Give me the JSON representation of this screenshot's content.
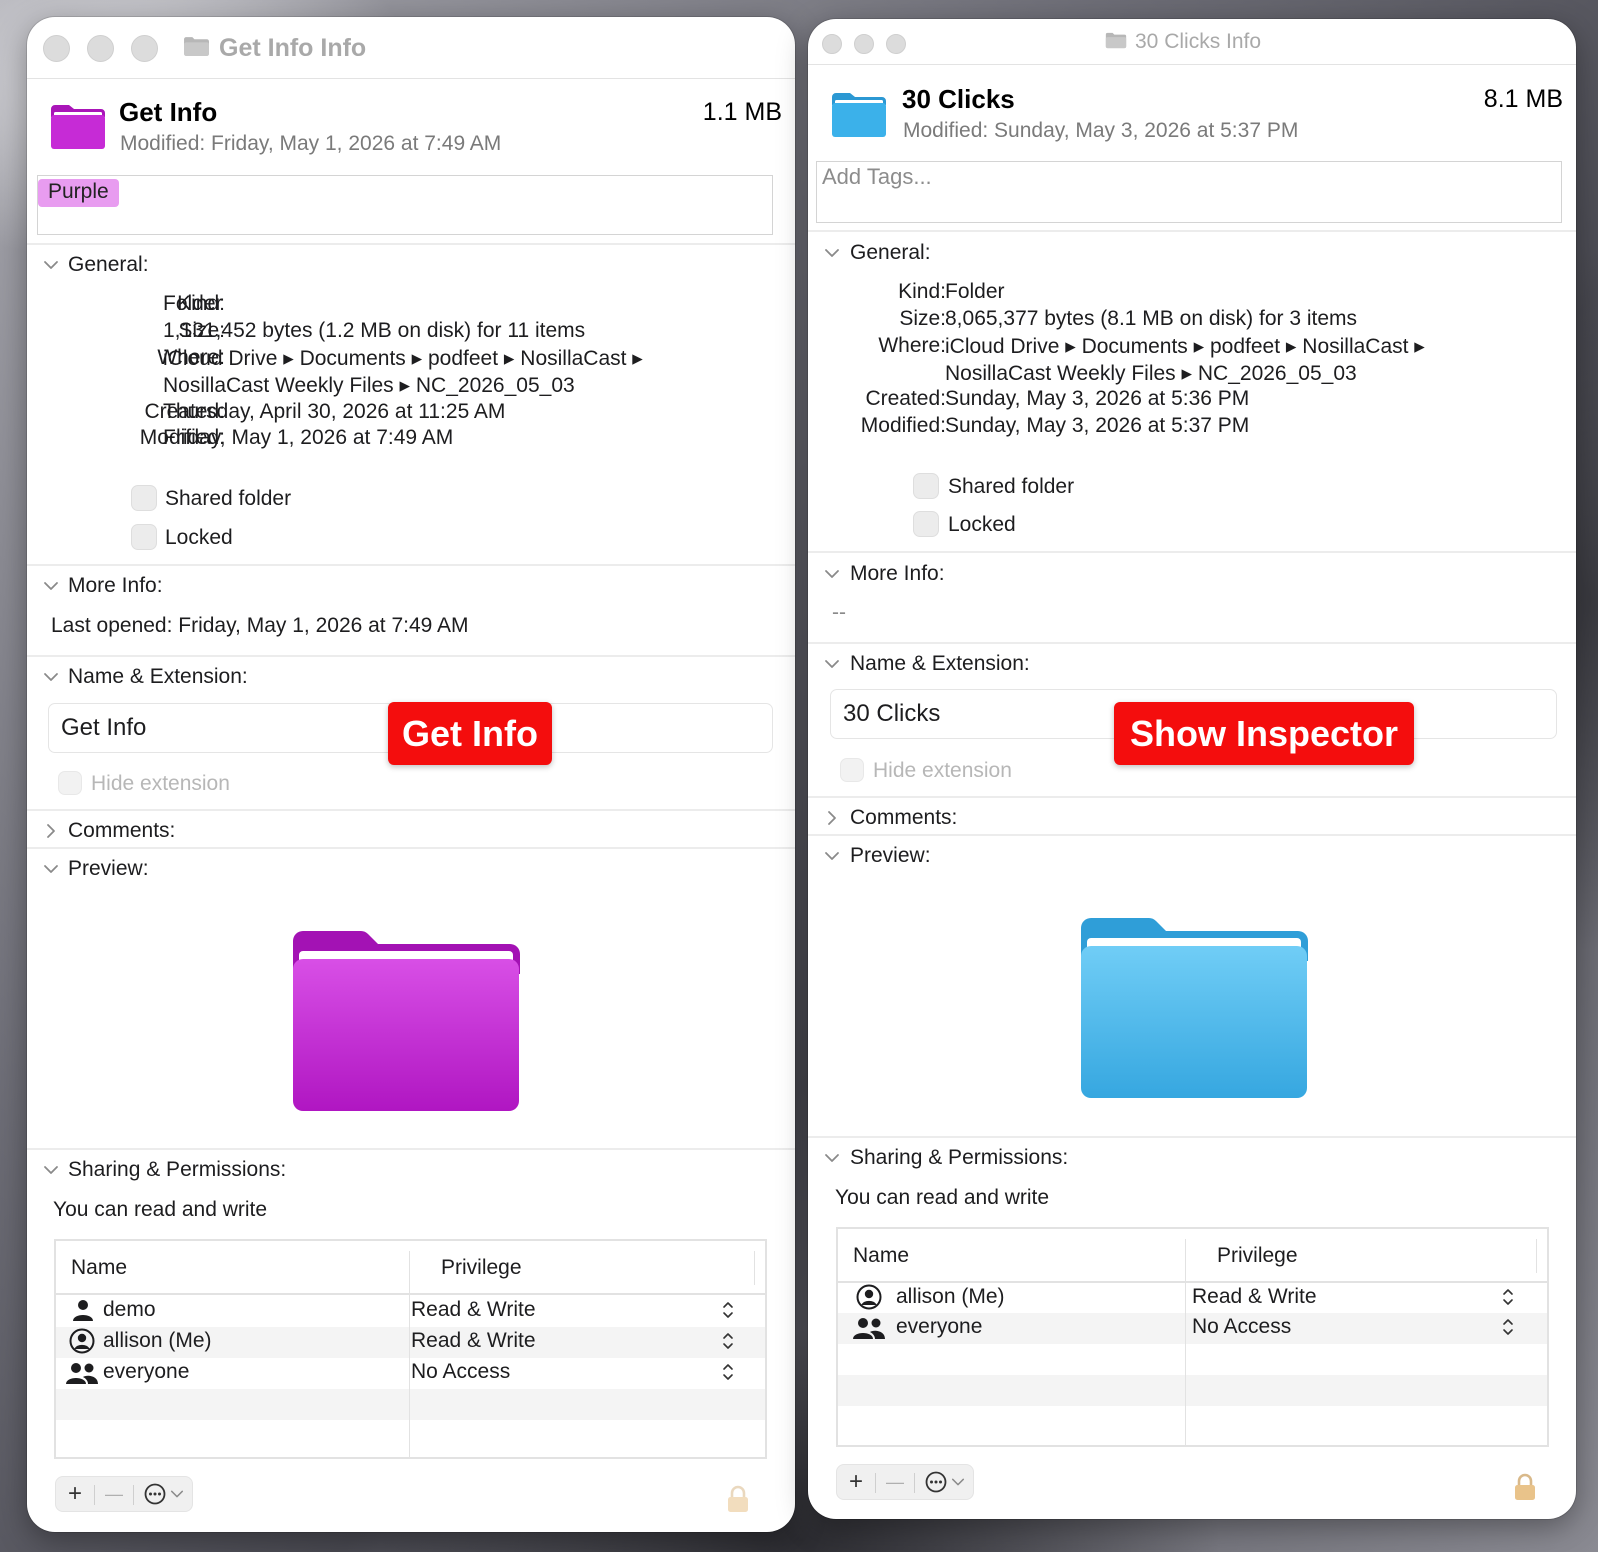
{
  "left": {
    "window_title": "Get Info Info",
    "file_name": "Get Info",
    "file_size": "1.1 MB",
    "modified_line": "Modified:  Friday, May 1, 2026 at 7:49 AM",
    "tag": "Purple",
    "folder_color": "#c62bd6",
    "general_title": "General:",
    "general": {
      "kind_label": "Kind:",
      "kind": "Folder",
      "size_label": "Size:",
      "size": "1,131,452 bytes (1.2 MB on disk) for 11 items",
      "where_label": "Where:",
      "where_1": "iCloud Drive ▸ Documents ▸ podfeet ▸ NosillaCast ▸",
      "where_2": "NosillaCast Weekly Files ▸ NC_2026_05_03",
      "created_label": "Created:",
      "created": "Thursday, April 30, 2026 at 11:25 AM",
      "modified_label": "Modified:",
      "modified": "Friday, May 1, 2026 at 7:49 AM"
    },
    "shared_folder": "Shared folder",
    "locked": "Locked",
    "more_info_title": "More Info:",
    "last_opened": "Last opened:  Friday, May 1, 2026 at 7:49 AM",
    "name_ext_title": "Name & Extension:",
    "name_value": "Get Info",
    "hide_extension": "Hide extension",
    "overlay_label": "Get Info",
    "comments_title": "Comments:",
    "preview_title": "Preview:",
    "sharing_title": "Sharing & Permissions:",
    "sharing_note": "You can read and write",
    "col_name": "Name",
    "col_privilege": "Privilege",
    "rows": [
      {
        "name": "demo",
        "privilege": "Read & Write",
        "icon": "person-icon"
      },
      {
        "name": "allison (Me)",
        "privilege": "Read & Write",
        "icon": "person-circle-icon"
      },
      {
        "name": "everyone",
        "privilege": "No Access",
        "icon": "people-icon"
      }
    ]
  },
  "right": {
    "window_title": "30 Clicks Info",
    "file_name": "30 Clicks",
    "file_size": "8.1 MB",
    "modified_line": "Modified:  Sunday, May 3, 2026 at 5:37 PM",
    "tags_placeholder": "Add Tags...",
    "folder_color": "#3bb1ea",
    "general_title": "General:",
    "general": {
      "kind_label": "Kind:",
      "kind": "Folder",
      "size_label": "Size:",
      "size": "8,065,377 bytes (8.1 MB on disk) for 3 items",
      "where_label": "Where:",
      "where_1": "iCloud Drive ▸ Documents ▸ podfeet ▸ NosillaCast ▸",
      "where_2": "NosillaCast Weekly Files ▸ NC_2026_05_03",
      "created_label": "Created:",
      "created": "Sunday, May 3, 2026 at 5:36 PM",
      "modified_label": "Modified:",
      "modified": "Sunday, May 3, 2026 at 5:37 PM"
    },
    "shared_folder": "Shared folder",
    "locked": "Locked",
    "more_info_title": "More Info:",
    "more_info_value": "--",
    "name_ext_title": "Name & Extension:",
    "name_value": "30 Clicks",
    "hide_extension": "Hide extension",
    "overlay_label": "Show Inspector",
    "comments_title": "Comments:",
    "preview_title": "Preview:",
    "sharing_title": "Sharing & Permissions:",
    "sharing_note": "You can read and write",
    "col_name": "Name",
    "col_privilege": "Privilege",
    "rows": [
      {
        "name": "allison (Me)",
        "privilege": "Read & Write",
        "icon": "person-circle-icon"
      },
      {
        "name": "everyone",
        "privilege": "No Access",
        "icon": "people-icon"
      }
    ]
  },
  "icons": {
    "chevron_down": "chevron-down-icon",
    "chevron_right": "chevron-right-icon",
    "add": "+",
    "remove": "—",
    "action": "ellipsis-circle-icon",
    "lock": "lock-icon"
  }
}
